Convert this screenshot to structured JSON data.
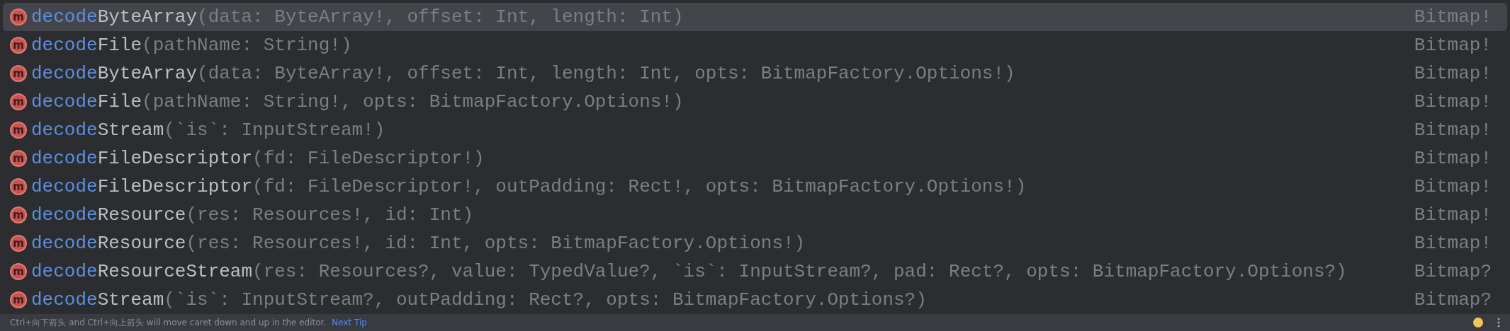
{
  "items": [
    {
      "icon": "m",
      "match": "decode",
      "name": "ByteArray",
      "params": "(data: ByteArray!, offset: Int, length: Int)",
      "type": "Bitmap!",
      "selected": true
    },
    {
      "icon": "m",
      "match": "decode",
      "name": "File",
      "params": "(pathName: String!)",
      "type": "Bitmap!",
      "selected": false
    },
    {
      "icon": "m",
      "match": "decode",
      "name": "ByteArray",
      "params": "(data: ByteArray!, offset: Int, length: Int, opts: BitmapFactory.Options!)",
      "type": "Bitmap!",
      "selected": false
    },
    {
      "icon": "m",
      "match": "decode",
      "name": "File",
      "params": "(pathName: String!, opts: BitmapFactory.Options!)",
      "type": "Bitmap!",
      "selected": false
    },
    {
      "icon": "m",
      "match": "decode",
      "name": "Stream",
      "params": "(`is`: InputStream!)",
      "type": "Bitmap!",
      "selected": false
    },
    {
      "icon": "m",
      "match": "decode",
      "name": "FileDescriptor",
      "params": "(fd: FileDescriptor!)",
      "type": "Bitmap!",
      "selected": false
    },
    {
      "icon": "m",
      "match": "decode",
      "name": "FileDescriptor",
      "params": "(fd: FileDescriptor!, outPadding: Rect!, opts: BitmapFactory.Options!)",
      "type": "Bitmap!",
      "selected": false
    },
    {
      "icon": "m",
      "match": "decode",
      "name": "Resource",
      "params": "(res: Resources!, id: Int)",
      "type": "Bitmap!",
      "selected": false
    },
    {
      "icon": "m",
      "match": "decode",
      "name": "Resource",
      "params": "(res: Resources!, id: Int, opts: BitmapFactory.Options!)",
      "type": "Bitmap!",
      "selected": false
    },
    {
      "icon": "m",
      "match": "decode",
      "name": "ResourceStream",
      "params": "(res: Resources?, value: TypedValue?, `is`: InputStream?, pad: Rect?, opts: BitmapFactory.Options?)",
      "type": "Bitmap?",
      "selected": false
    },
    {
      "icon": "m",
      "match": "decode",
      "name": "Stream",
      "params": "(`is`: InputStream?, outPadding: Rect?, opts: BitmapFactory.Options?)",
      "type": "Bitmap?",
      "selected": false
    }
  ],
  "status_bar": {
    "hint": "Ctrl+向下箭头 and Ctrl+向上箭头 will move caret down and up in the editor.",
    "link": "Next Tip"
  }
}
